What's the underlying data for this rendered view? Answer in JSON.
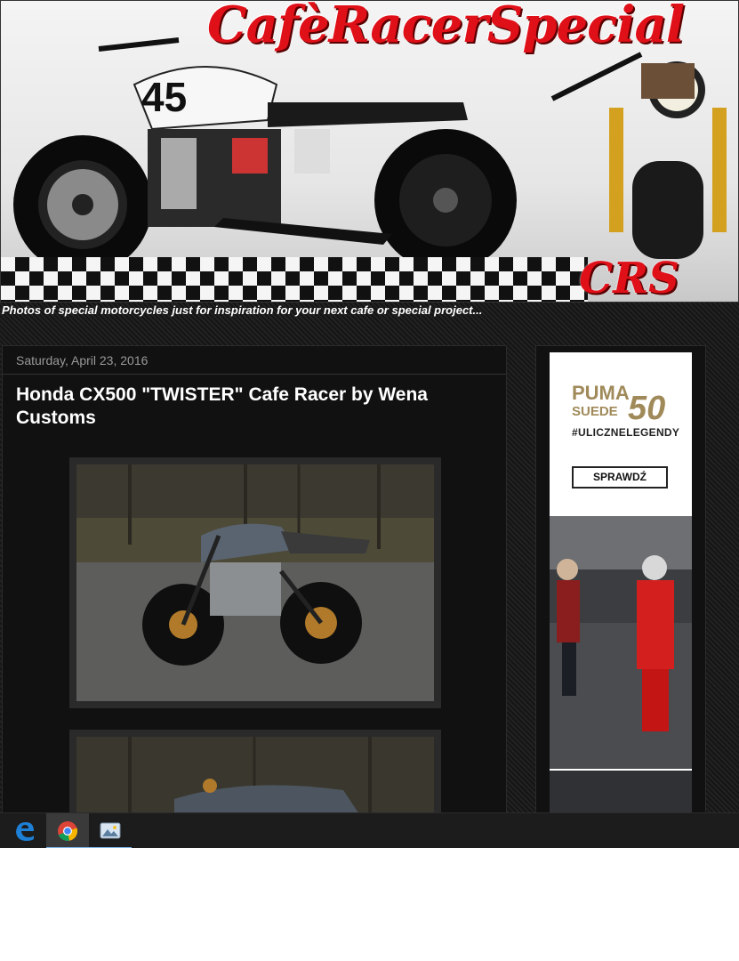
{
  "header": {
    "site_title": "CafèRacerSpecial",
    "logo_text": "CRS",
    "tagline": "Photos of special motorcycles just for inspiration for your next cafe or special project...",
    "bike_number": "45"
  },
  "post": {
    "date": "Saturday, April 23, 2016",
    "title": "Honda CX500 \"TWISTER\" Cafe Racer by Wena Customs"
  },
  "sidebar_ad": {
    "brand": "PUMA",
    "brand_sub": "SUEDE",
    "anniversary": "50",
    "hashtag": "#ULICZNELEGENDY",
    "cta_label": "SPRAWDŹ"
  },
  "taskbar": {
    "apps": [
      {
        "name": "edge-icon",
        "active": false
      },
      {
        "name": "chrome-icon",
        "active": true
      },
      {
        "name": "photos-icon",
        "active": false
      }
    ]
  },
  "colors": {
    "brand_red": "#e01019",
    "ad_gold": "#a08a5a",
    "page_bg": "#1a1a1a",
    "taskbar_accent": "#7eb4ea"
  }
}
